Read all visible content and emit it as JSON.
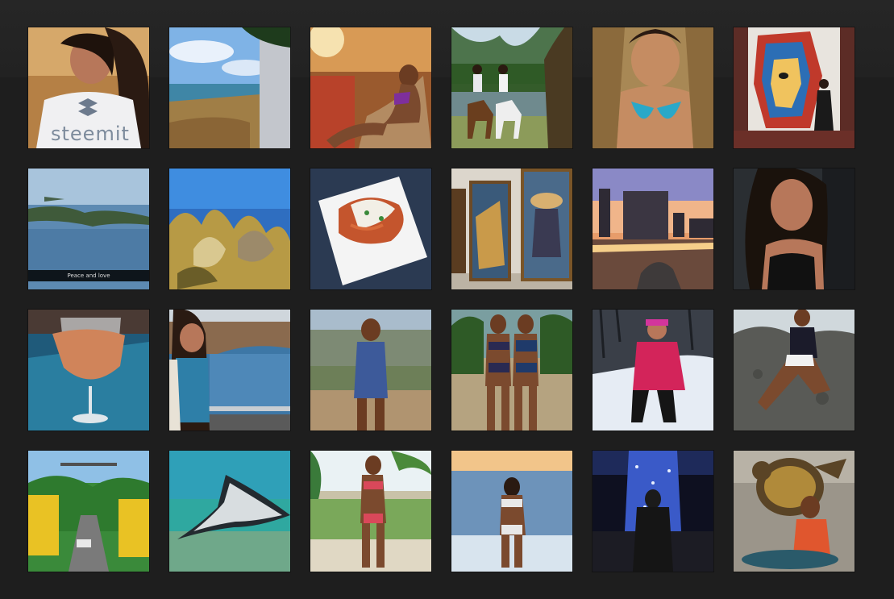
{
  "gallery": {
    "tiles": [
      {
        "subject": "selfie-steemit-shirt",
        "text": "steemit"
      },
      {
        "subject": "beach-rocky-shore"
      },
      {
        "subject": "woman-purple-bikini-rock"
      },
      {
        "subject": "horseback-riders-stream"
      },
      {
        "subject": "bikini-selfie-wicker-chair"
      },
      {
        "subject": "street-mural-woman"
      },
      {
        "subject": "aerial-island-coast",
        "caption": "Peace and love"
      },
      {
        "subject": "underwater-coral"
      },
      {
        "subject": "plated-dish-white-plate"
      },
      {
        "subject": "museum-paintings"
      },
      {
        "subject": "sunset-city-waterfront"
      },
      {
        "subject": "selfie-black-top"
      },
      {
        "subject": "glass-of-rose-wine"
      },
      {
        "subject": "woman-seaside-railing"
      },
      {
        "subject": "woman-overlook-hills"
      },
      {
        "subject": "two-women-bikinis-beach"
      },
      {
        "subject": "snowboarder-pink-jacket"
      },
      {
        "subject": "woman-rock-wall"
      },
      {
        "subject": "yellow-suspension-bridge"
      },
      {
        "subject": "stingray-underwater"
      },
      {
        "subject": "woman-beach-palms"
      },
      {
        "subject": "woman-ocean-shoreline"
      },
      {
        "subject": "christmas-lights-tree-night"
      },
      {
        "subject": "woman-turtle-statue"
      }
    ]
  },
  "colors": {
    "background": "#1e1e1e",
    "tile_border": "#000000"
  }
}
